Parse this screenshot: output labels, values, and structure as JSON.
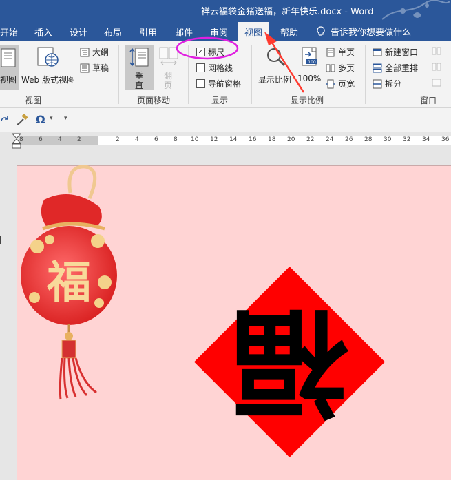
{
  "title_bar": {
    "title": "祥云福袋金猪送福，新年快乐.docx  -  Word"
  },
  "tabs": [
    {
      "label": "开始"
    },
    {
      "label": "插入"
    },
    {
      "label": "设计"
    },
    {
      "label": "布局"
    },
    {
      "label": "引用"
    },
    {
      "label": "邮件"
    },
    {
      "label": "审阅"
    },
    {
      "label": "视图",
      "active": true
    },
    {
      "label": "帮助"
    }
  ],
  "tell_me": {
    "label": "告诉我你想要做什么"
  },
  "ribbon": {
    "views": {
      "label": "视图",
      "read_mode_partial": "视图",
      "web_layout": "Web 版式视图",
      "outline": "大纲",
      "draft": "草稿"
    },
    "page_movement": {
      "label": "页面移动",
      "vertical": "垂直",
      "side_to_side": "翻页"
    },
    "show": {
      "label": "显示",
      "ruler": "标尺",
      "ruler_checked": true,
      "gridlines": "网格线",
      "gridlines_checked": false,
      "nav_pane": "导航窗格",
      "nav_pane_checked": false
    },
    "zoom": {
      "label": "显示比例",
      "zoom_button": "显示比例",
      "hundred": "100%",
      "hundred_icon_text": "100",
      "one_page": "单页",
      "multi_page": "多页",
      "page_width": "页宽"
    },
    "window": {
      "label": "窗口",
      "new_window": "新建窗口",
      "arrange_all": "全部重排",
      "split": "拆分"
    }
  },
  "quick_access": {
    "symbol": "Ω"
  },
  "ruler": {
    "left_numbers": [
      "8",
      "6",
      "4",
      "2"
    ],
    "right_numbers": [
      "2",
      "4",
      "6",
      "8",
      "10",
      "12",
      "14",
      "16",
      "18",
      "20",
      "22",
      "24",
      "26",
      "28",
      "30",
      "32",
      "34",
      "36"
    ]
  },
  "document": {
    "page_color": "#ffd4d4",
    "pouch_character": "福",
    "diamond_character": "福",
    "diamond_color": "#ff0000"
  },
  "colors": {
    "accent": "#2b579a",
    "annotation_circle": "#e020e0",
    "arrow": "#ff3b30"
  }
}
